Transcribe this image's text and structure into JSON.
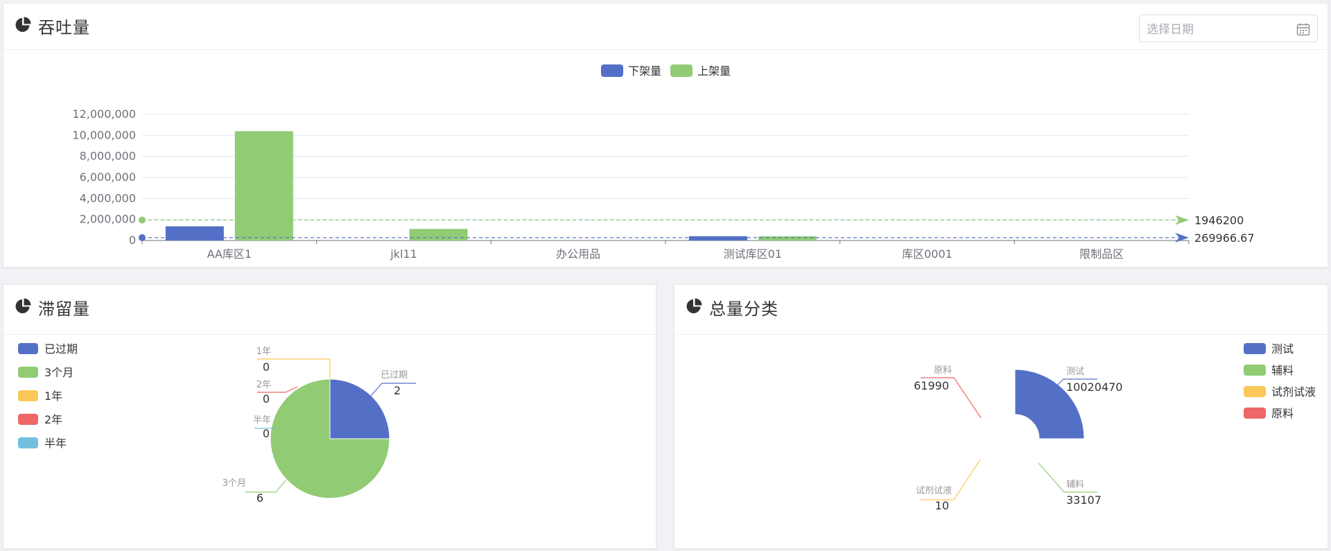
{
  "throughput": {
    "title": "吞吐量",
    "date_placeholder": "选择日期"
  },
  "retention": {
    "title": "滞留量"
  },
  "total": {
    "title": "总量分类"
  },
  "colors": {
    "blue": "#5470c6",
    "green": "#91cc75",
    "yellow": "#fac858",
    "red": "#ee6666",
    "cyan": "#73c0de"
  },
  "chart_data": [
    {
      "type": "bar",
      "title": "吞吐量",
      "categories": [
        "AA库区1",
        "jkl11",
        "办公用品",
        "测试库区01",
        "库区0001",
        "限制品区"
      ],
      "series": [
        {
          "name": "下架量",
          "color": "#5470c6",
          "values": [
            1350000,
            0,
            0,
            410000,
            0,
            0
          ],
          "markLine": {
            "value": 269966.67,
            "label": "269966.67"
          }
        },
        {
          "name": "上架量",
          "color": "#91cc75",
          "values": [
            10400000,
            1100000,
            0,
            400000,
            0,
            0
          ],
          "markLine": {
            "value": 1946200,
            "label": "1946200"
          }
        }
      ],
      "ylim": [
        0,
        12000000
      ],
      "yticks": [
        0,
        2000000,
        4000000,
        6000000,
        8000000,
        10000000,
        12000000
      ],
      "ytick_labels": [
        "0",
        "2,000,000",
        "4,000,000",
        "6,000,000",
        "8,000,000",
        "10,000,000",
        "12,000,000"
      ],
      "legend_position": "top-center",
      "grid": true
    },
    {
      "type": "pie",
      "title": "滞留量",
      "slices": [
        {
          "name": "已过期",
          "value": 2,
          "color": "#5470c6"
        },
        {
          "name": "3个月",
          "value": 6,
          "color": "#91cc75"
        },
        {
          "name": "1年",
          "value": 0,
          "color": "#fac858"
        },
        {
          "name": "2年",
          "value": 0,
          "color": "#ee6666"
        },
        {
          "name": "半年",
          "value": 0,
          "color": "#73c0de"
        }
      ],
      "legend_position": "left"
    },
    {
      "type": "pie",
      "title": "总量分类",
      "rose": true,
      "slices": [
        {
          "name": "测试",
          "value": 10020470,
          "color": "#5470c6"
        },
        {
          "name": "辅料",
          "value": 33107,
          "color": "#91cc75"
        },
        {
          "name": "试剂试液",
          "value": 10,
          "color": "#fac858"
        },
        {
          "name": "原料",
          "value": 61990,
          "color": "#ee6666"
        }
      ],
      "legend_position": "right"
    }
  ]
}
